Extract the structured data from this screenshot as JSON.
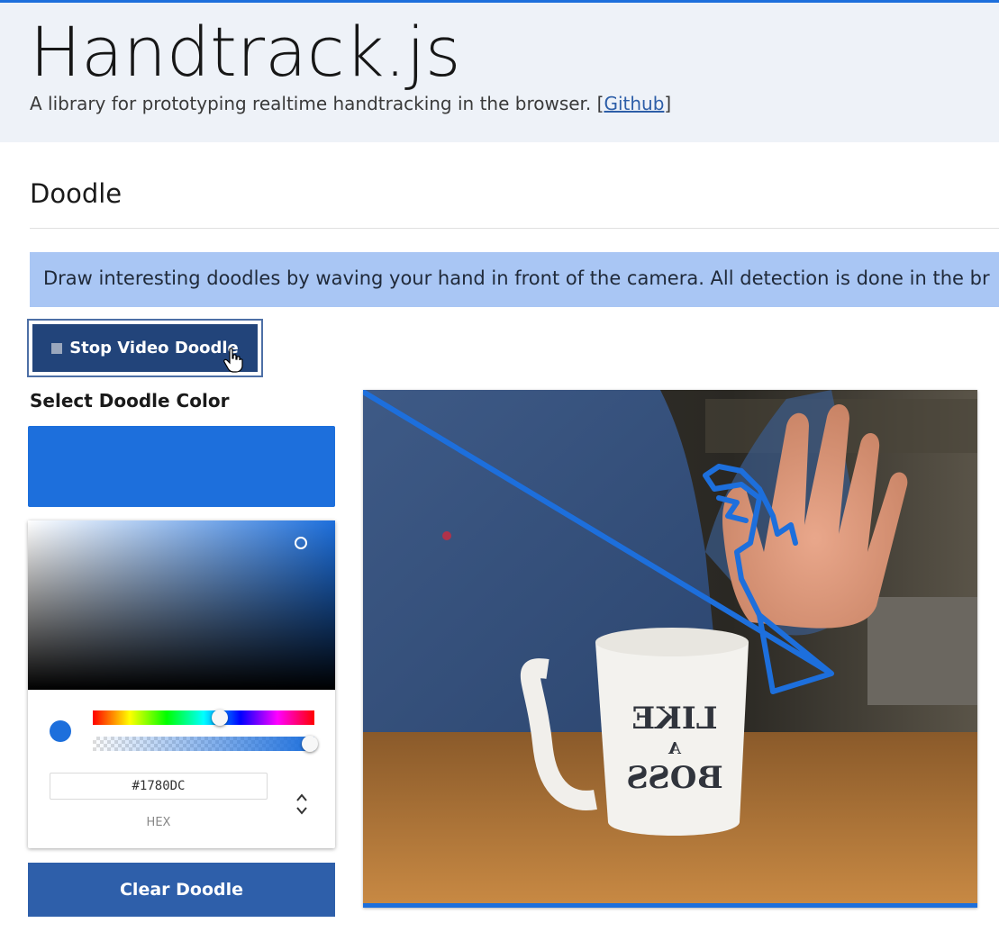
{
  "header": {
    "title": "Handtrack.js",
    "subtitle_prefix": "A library for prototyping realtime handtracking in the browser. [",
    "github_link": "Github",
    "subtitle_suffix": "]"
  },
  "section": {
    "title": "Doodle"
  },
  "banner": {
    "text": "Draw interesting doodles by waving your hand in front of the camera. All detection is done in the br"
  },
  "controls": {
    "stop_button_label": "Stop Video Doodle",
    "color_label": "Select Doodle Color",
    "clear_button_label": "Clear Doodle"
  },
  "color_picker": {
    "hex_value": "#1780DC",
    "format_label": "HEX",
    "selected_color": "#1780DC"
  },
  "video": {
    "mug_text": [
      "LIKE",
      "A",
      "BOSS"
    ]
  },
  "colors": {
    "accent": "#1d6fdc",
    "button_dark": "#22447a",
    "button_clear": "#2e5faa",
    "banner_bg": "#a9c6f4",
    "header_bg": "#eef2f8"
  },
  "icons": {
    "stop": "stop-icon",
    "cursor": "hand-pointer-icon",
    "toggle": "chevron-up-down-icon"
  }
}
